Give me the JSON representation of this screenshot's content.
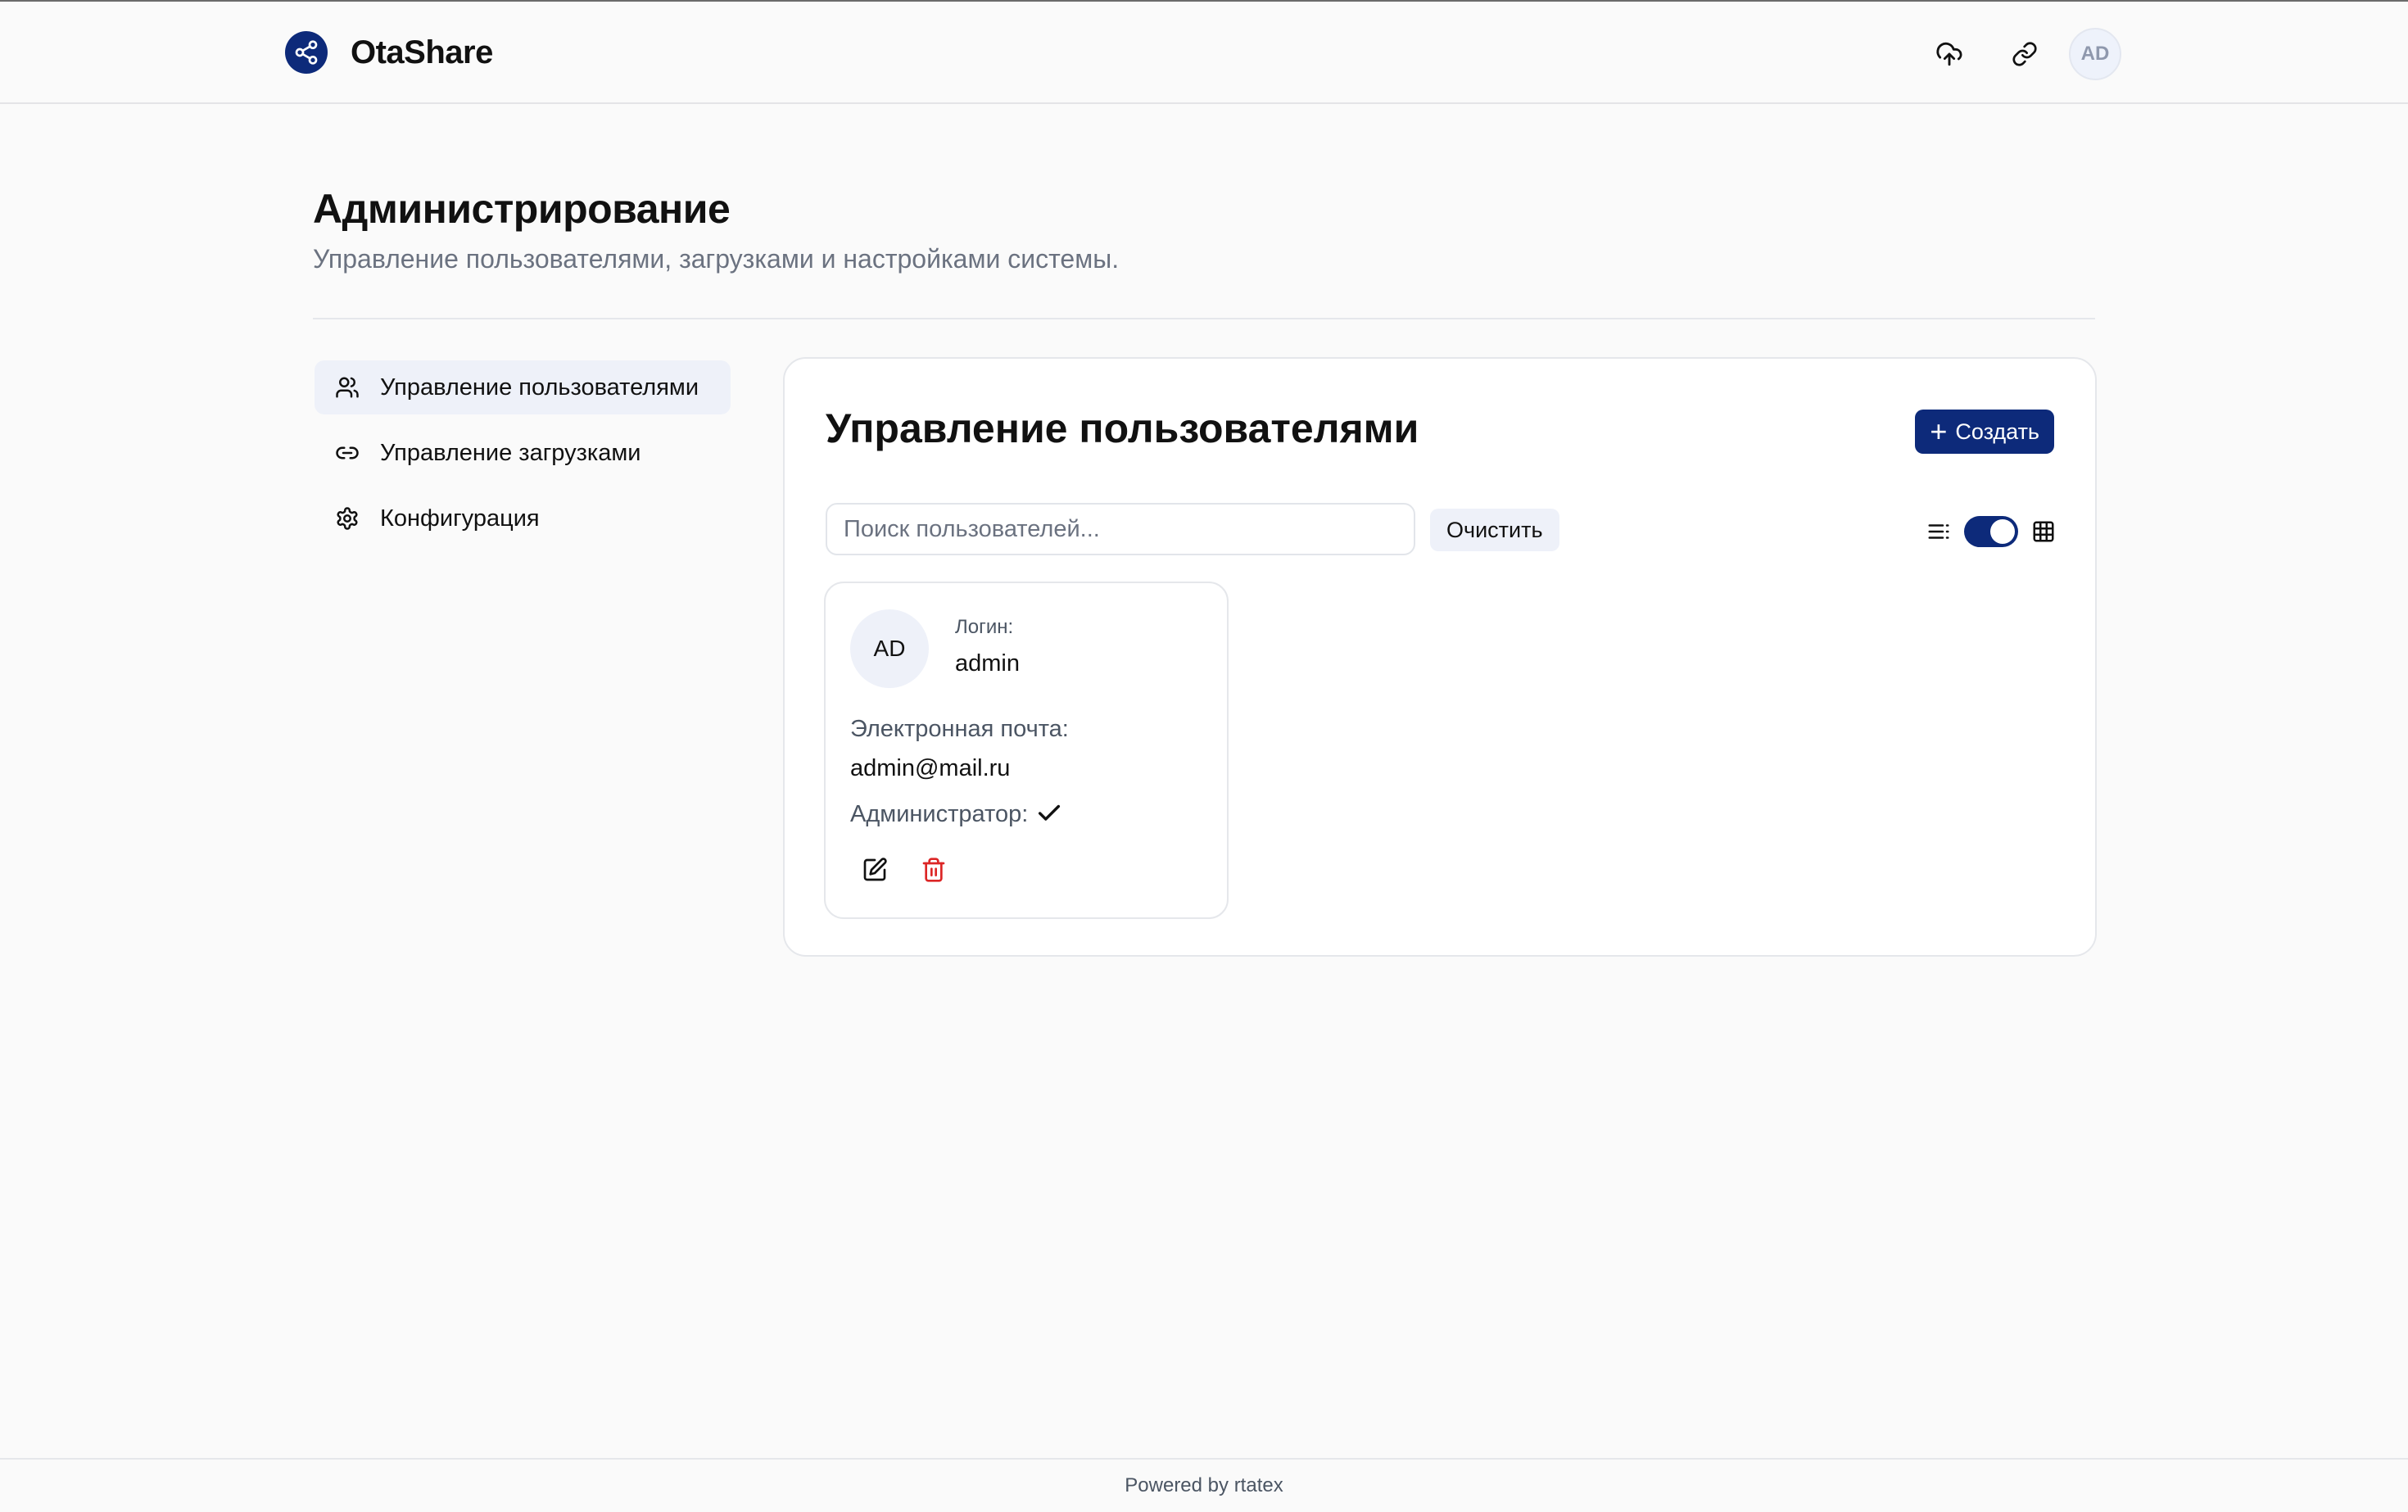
{
  "header": {
    "brand_name": "OtaShare",
    "upload_icon": "cloud-upload-icon",
    "link_icon": "link-icon",
    "avatar_initials": "AD"
  },
  "page": {
    "title": "Администрирование",
    "subtitle": "Управление пользователями, загрузками и настройками системы."
  },
  "sidebar": {
    "items": [
      {
        "label": "Управление пользователями",
        "icon": "users-icon",
        "active": true
      },
      {
        "label": "Управление загрузками",
        "icon": "link-icon",
        "active": false
      },
      {
        "label": "Конфигурация",
        "icon": "gear-icon",
        "active": false
      }
    ]
  },
  "main": {
    "title": "Управление пользователями",
    "create_label": "Создать",
    "search": {
      "placeholder": "Поиск пользователей...",
      "value": ""
    },
    "clear_label": "Очистить",
    "view_toggle": {
      "mode": "grid",
      "on": true
    }
  },
  "users": [
    {
      "avatar_initials": "AD",
      "login_label": "Логин:",
      "login": "admin",
      "email_label": "Электронная почта:",
      "email": "admin@mail.ru",
      "admin_label": "Администратор:",
      "is_admin": true
    }
  ],
  "footer": {
    "text": "Powered by rtatex"
  },
  "colors": {
    "accent": "#0d2a7a",
    "danger": "#dc2626",
    "nav_active_bg": "#eef1f9"
  }
}
